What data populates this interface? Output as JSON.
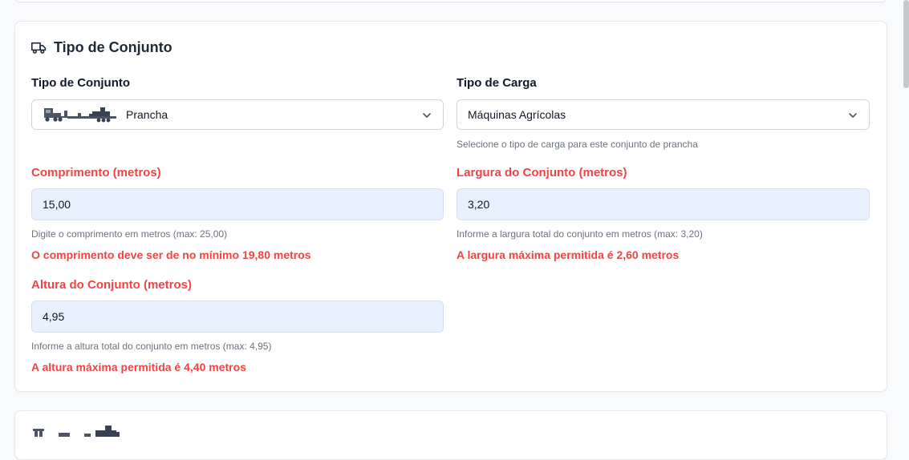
{
  "section": {
    "title": "Tipo de Conjunto"
  },
  "tipo_conjunto": {
    "label": "Tipo de Conjunto",
    "value": "Prancha"
  },
  "tipo_carga": {
    "label": "Tipo de Carga",
    "value": "Máquinas Agrícolas",
    "help": "Selecione o tipo de carga para este conjunto de prancha"
  },
  "comprimento": {
    "label": "Comprimento (metros)",
    "value": "15,00",
    "help": "Digite o comprimento em metros (max: 25,00)",
    "error": "O comprimento deve ser de no mínimo 19,80 metros"
  },
  "largura": {
    "label": "Largura do Conjunto (metros)",
    "value": "3,20",
    "help": "Informe a largura total do conjunto em metros (max: 3,20)",
    "error": "A largura máxima permitida é 2,60 metros"
  },
  "altura": {
    "label": "Altura do Conjunto (metros)",
    "value": "4,95",
    "help": "Informe a altura total do conjunto em metros (max: 4,95)",
    "error": "A altura máxima permitida é 4,40 metros"
  },
  "icons": {
    "section": "truck-icon",
    "vehicle": "truck-lowboy-icon",
    "chevron": "chevron-down-icon"
  },
  "colors": {
    "error": "#ef4444",
    "input_bg": "#e8f0fe",
    "border": "#d1d5db"
  }
}
